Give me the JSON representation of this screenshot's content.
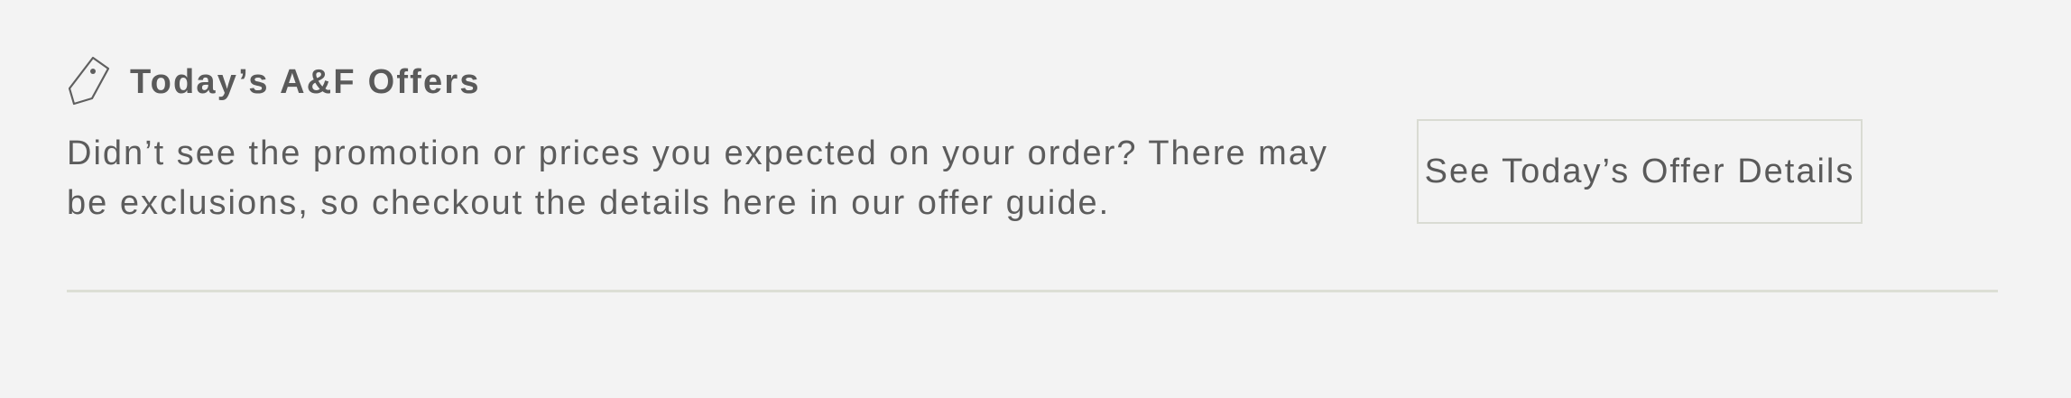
{
  "offers": {
    "icon": "price-tag-icon",
    "heading": "Today’s A&F Offers",
    "description": "Didn’t see the promotion or prices you expected on your order? There may be exclusions, so checkout the details here in our offer guide.",
    "button_label": "See Today’s Offer Details"
  },
  "colors": {
    "background": "#f3f3f3",
    "text": "#5c5c5c",
    "border": "#d9dbd3"
  }
}
